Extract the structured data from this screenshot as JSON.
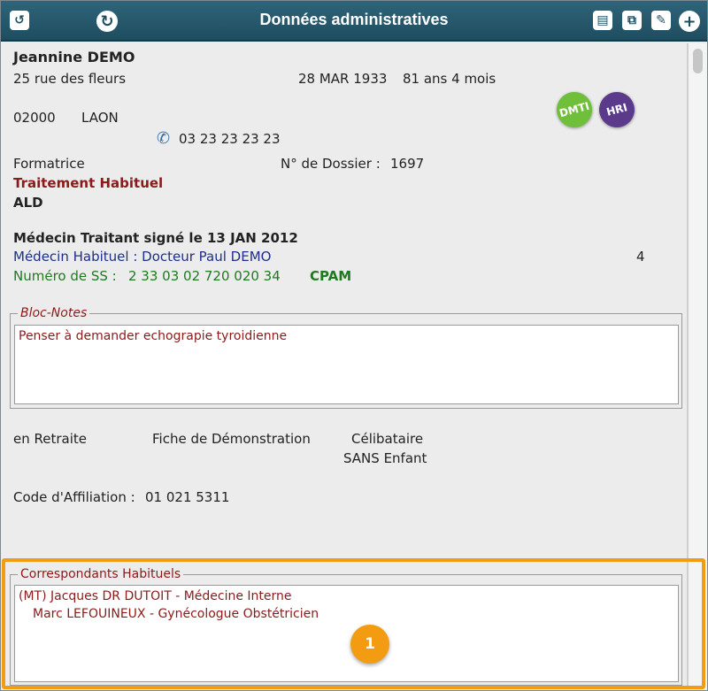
{
  "window": {
    "title": "Données administratives",
    "toolbar": {
      "back_icon": "undo-icon",
      "refresh_icon": "refresh-icon",
      "print_icon": "print-icon",
      "copy_icon": "copy-icon",
      "edit_icon": "edit-icon",
      "add_icon": "add-icon"
    }
  },
  "patient": {
    "name": "Jeannine DEMO",
    "address": "25 rue des fleurs",
    "birth_date": "28 MAR 1933",
    "age": "81 ans 4 mois",
    "postal_code": "02000",
    "city": "LAON",
    "phone": "03 23 23 23 23",
    "profession": "Formatrice",
    "dossier_label": "N° de Dossier :",
    "dossier_number": "1697",
    "treatment_label": "Traitement Habituel",
    "ald": "ALD",
    "badges": [
      {
        "label": "DMTI",
        "color": "#6fbf3a"
      },
      {
        "label": "HRI",
        "color": "#5b3a8c"
      }
    ]
  },
  "medecin": {
    "traitant_label": "Médecin Traitant signé le 13 JAN 2012",
    "habituel": "Médecin Habituel : Docteur Paul DEMO",
    "count": "4",
    "ss_label": "Numéro de SS :",
    "ss_number": "2 33 03 02 720 020 34",
    "caisse": "CPAM"
  },
  "bloc_notes": {
    "legend": "Bloc-Notes",
    "text": "Penser à demander echograpie tyroidienne"
  },
  "situation": {
    "retraite": "en Retraite",
    "fiche": "Fiche de Démonstration",
    "etat_civil": "Célibataire",
    "enfants": "SANS Enfant",
    "affiliation_label": "Code d'Affiliation :",
    "affiliation_code": "01  021  5311"
  },
  "correspondants": {
    "legend": "Correspondants Habituels",
    "items": [
      "(MT) Jacques DR DUTOIT - Médecine Interne",
      "Marc LEFOUINEUX - Gynécologue Obstétricien"
    ]
  },
  "callout": {
    "number": "1",
    "color": "#f39c12"
  }
}
